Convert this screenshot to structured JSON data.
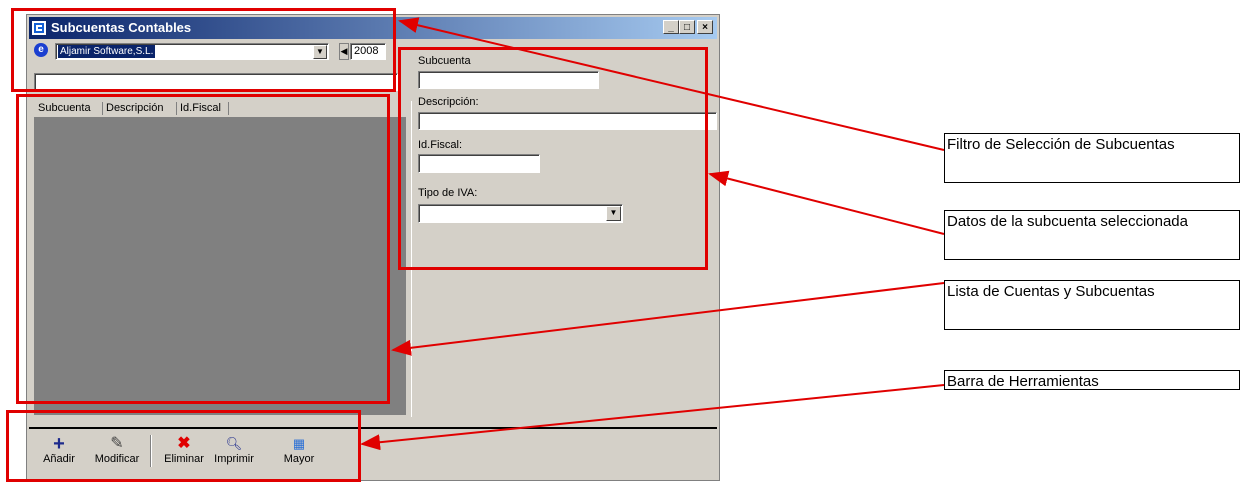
{
  "window": {
    "title": "Subcuentas Contables",
    "buttons": [
      "_",
      "□",
      "×"
    ]
  },
  "filter": {
    "company": "Aljamir Software,S.L.",
    "year": "2008",
    "search_value": ""
  },
  "list": {
    "columns": [
      "Subcuenta",
      "Descripción",
      "Id.Fiscal"
    ],
    "rows": []
  },
  "details": {
    "subcuenta_label": "Subcuenta",
    "descripcion_label": "Descripción:",
    "idfiscal_label": "Id.Fiscal:",
    "tipoiva_label": "Tipo de IVA:",
    "subcuenta_value": "",
    "descripcion_value": "",
    "idfiscal_value": "",
    "tipoiva_value": ""
  },
  "toolbar": {
    "add_label": "Añadir",
    "modify_label": "Modificar",
    "delete_label": "Eliminar",
    "print_label": "Imprimir",
    "ledger_label": "Mayor"
  },
  "callouts": {
    "filter": "Filtro de Selección de Subcuentas",
    "details": "Datos de la subcuenta seleccionada",
    "list": "Lista de Cuentas y Subcuentas",
    "toolbar": "Barra de Herramientas"
  },
  "colors": {
    "annotation": "#e00000",
    "titlebar_start": "#0a246a",
    "titlebar_end": "#a6caf0",
    "window_bg": "#d4d0c8",
    "list_bg": "#808080"
  }
}
